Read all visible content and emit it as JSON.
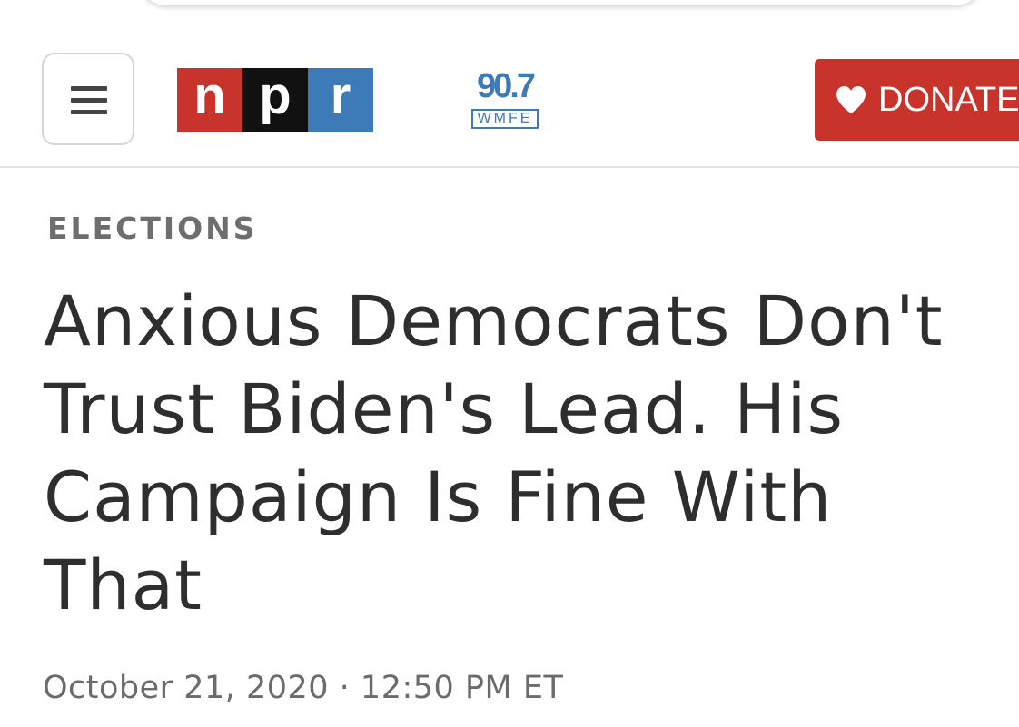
{
  "header": {
    "logo": {
      "letters": [
        "n",
        "p",
        "r"
      ],
      "colors": [
        "#c8332b",
        "#111111",
        "#3d7ab8"
      ]
    },
    "station": {
      "frequency": "90.7",
      "call_sign": "WMFE",
      "color": "#3d7ab8"
    },
    "menu_icon": "hamburger-menu-icon",
    "donate": {
      "label": "DONATE",
      "icon": "heart-icon",
      "color": "#c8332b"
    }
  },
  "article": {
    "section": "ELECTIONS",
    "headline": "Anxious Democrats Don't Trust Biden's Lead. His Campaign Is Fine With That",
    "dateline": "October 21, 2020 · 12:50 PM ET"
  }
}
